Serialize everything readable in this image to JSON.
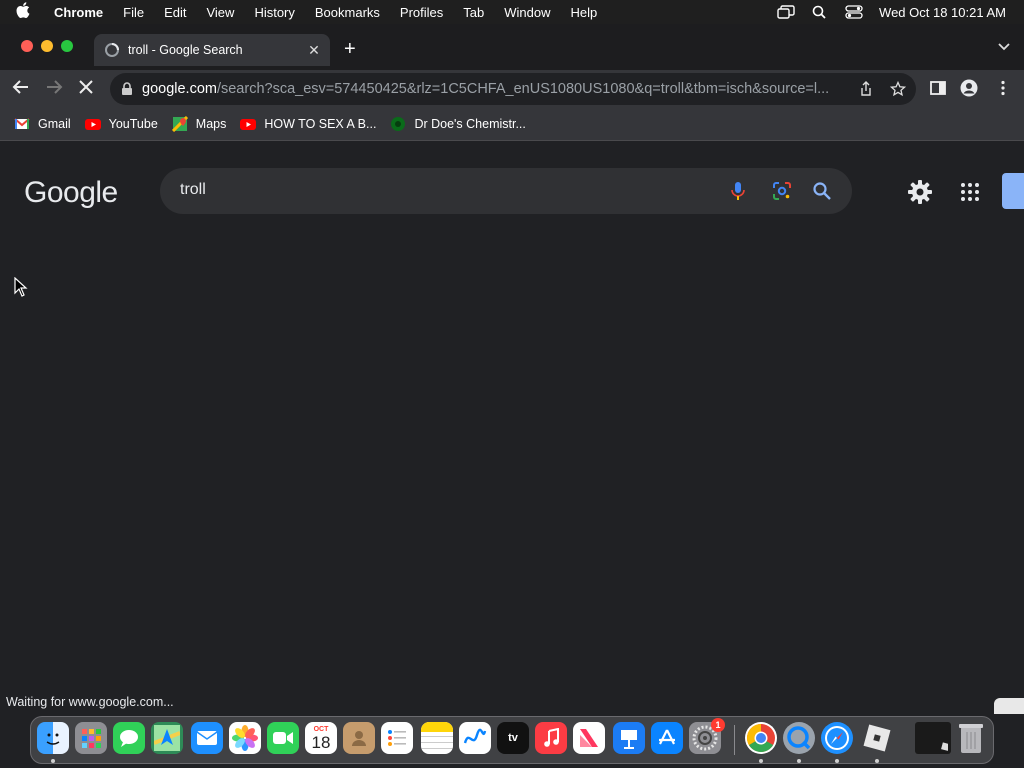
{
  "menubar": {
    "app": "Chrome",
    "items": [
      "File",
      "Edit",
      "View",
      "History",
      "Bookmarks",
      "Profiles",
      "Tab",
      "Window",
      "Help"
    ],
    "clock": "Wed Oct 18  10:21 AM"
  },
  "tab": {
    "title": "troll - Google Search"
  },
  "omnibox": {
    "host": "google.com",
    "path": "/search?sca_esv=574450425&rlz=1C5CHFA_enUS1080US1080&q=troll&tbm=isch&source=l..."
  },
  "bookmarks": [
    "Gmail",
    "YouTube",
    "Maps",
    "HOW TO SEX A B...",
    "Dr Doe's Chemistr..."
  ],
  "google": {
    "logo": "Google",
    "query": "troll"
  },
  "status": "Waiting for www.google.com...",
  "dock": {
    "calendar_month": "OCT",
    "calendar_day": "18",
    "appletv_label": "tv",
    "settings_badge": "1"
  },
  "colors": {
    "page_bg": "#202124",
    "toolbar_bg": "#35363a",
    "searchbox_bg": "#303134",
    "accent_blue": "#8ab4f8"
  }
}
